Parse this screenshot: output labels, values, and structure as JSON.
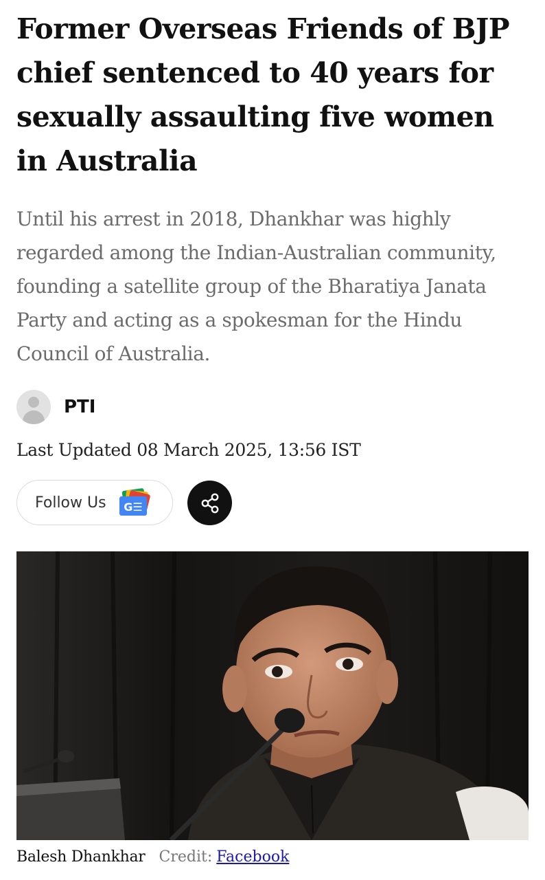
{
  "article": {
    "headline": "Former Overseas Friends of BJP chief sentenced to 40 years for sexually assaulting five women in Australia",
    "summary": "Until his arrest in 2018, Dhankhar was highly regarded among the Indian-Australian community, founding a satellite group of the Bharatiya Janata Party and acting as a spokesman for the Hindu Council of Australia.",
    "author": "PTI",
    "last_updated": "Last Updated 08 March 2025, 13:56 IST"
  },
  "actions": {
    "follow_label": "Follow Us",
    "follow_icon": "google-news-icon",
    "google_news_icon_text": "G☰",
    "share_icon": "share-icon"
  },
  "image": {
    "caption_name": "Balesh Dhankhar",
    "credit_label": "Credit:",
    "credit_link": "Facebook"
  },
  "colors": {
    "share_bg": "#111111",
    "link": "#1a1ab0",
    "summary_text": "#6b6b6b"
  }
}
